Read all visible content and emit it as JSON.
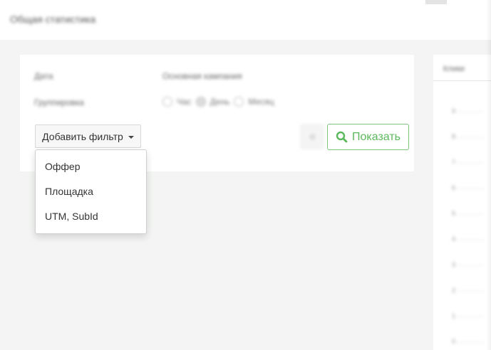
{
  "header": {
    "title": "Общая статистика"
  },
  "panel": {
    "date_label": "Дата",
    "campaign_label": "Основная кампания",
    "grouping_label": "Группировка",
    "grouping_options": [
      "Час",
      "День",
      "Месяц"
    ],
    "selected_grouping": "День"
  },
  "filter_button": {
    "label": "Добавить фильтр"
  },
  "filter_menu": {
    "items": [
      "Оффер",
      "Площадка",
      "UTM, SubId"
    ]
  },
  "show_button": {
    "label": "Показать"
  },
  "chart_panel": {
    "tab_label": "Клики",
    "ticks": [
      "9",
      "8",
      "7",
      "6",
      "5",
      "4",
      "3",
      "2",
      "1",
      "0"
    ]
  },
  "colors": {
    "accent_green": "#5cb85c"
  }
}
